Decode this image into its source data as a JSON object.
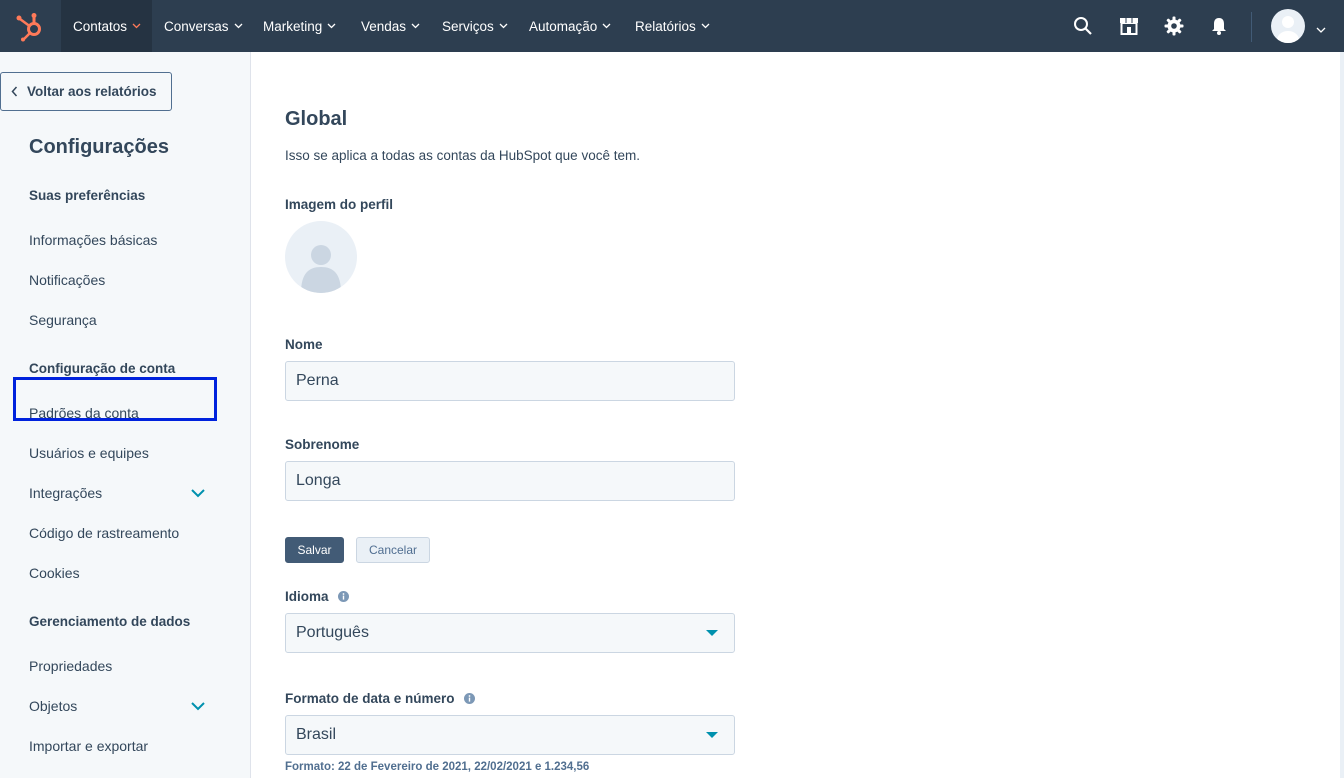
{
  "nav": {
    "items": [
      {
        "label": "Contatos",
        "active": true
      },
      {
        "label": "Conversas"
      },
      {
        "label": "Marketing"
      },
      {
        "label": "Vendas"
      },
      {
        "label": "Serviços"
      },
      {
        "label": "Automação"
      },
      {
        "label": "Relatórios"
      }
    ],
    "icons": [
      "search-icon",
      "marketplace-icon",
      "gear-icon",
      "bell-icon",
      "avatar"
    ]
  },
  "sidebar": {
    "back_label": "Voltar aos relatórios",
    "title": "Configurações",
    "sections": [
      {
        "heading": "Suas preferências",
        "items": [
          "Informações básicas",
          "Notificações",
          "Segurança"
        ]
      },
      {
        "heading": "Configuração de conta",
        "items": [
          "Padrões da conta",
          "Usuários e equipes",
          "Integrações",
          "Código de rastreamento",
          "Cookies"
        ]
      },
      {
        "heading": "Gerenciamento de dados",
        "items": [
          "Propriedades",
          "Objetos",
          "Importar e exportar"
        ]
      }
    ],
    "highlighted_item": "Usuários e equipes"
  },
  "main": {
    "title": "Global",
    "description": "Isso se aplica a todas as contas da HubSpot que você tem.",
    "profile_image_label": "Imagem do perfil",
    "first_name": {
      "label": "Nome",
      "value": "Perna"
    },
    "last_name": {
      "label": "Sobrenome",
      "value": "Longa"
    },
    "save_label": "Salvar",
    "cancel_label": "Cancelar",
    "language": {
      "label": "Idioma",
      "value": "Português"
    },
    "date_format": {
      "label": "Formato de data e número",
      "value": "Brasil",
      "hint": "Formato: 22 de Fevereiro de 2021, 22/02/2021 e 1.234,56"
    }
  },
  "colors": {
    "nav_bg": "#2d3e50",
    "accent_orange": "#ff7a59",
    "link_teal": "#0091ae",
    "highlight_blue": "#0022dd",
    "text": "#33475b"
  }
}
